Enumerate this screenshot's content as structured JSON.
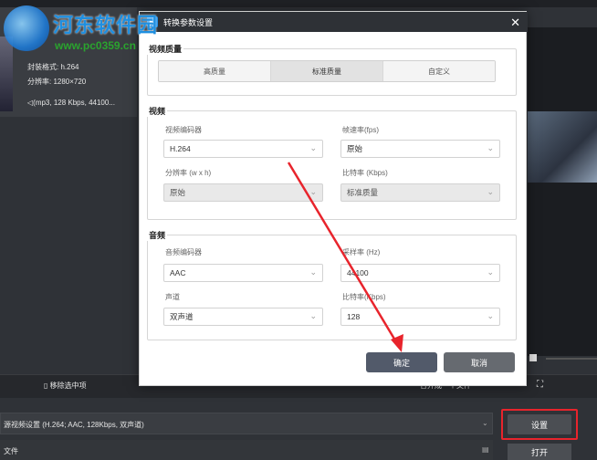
{
  "app": {
    "file_info": {
      "format_line": "封装格式: h.264",
      "resolution_line": "分辨率: 1280×720",
      "audio_line": "(mp3, 128 Kbps, 44100..."
    },
    "remove_selected": "移除选中项",
    "source_settings_line": "源视频设置 (H.264; AAC, 128Kbps, 双声道)",
    "file_label": "文件",
    "settings_button": "设置",
    "open_button": "打开",
    "merge_label": "合并成一个文件"
  },
  "watermark": {
    "title": "河东软件园",
    "url": "www.pc0359.cn"
  },
  "dialog": {
    "title": "转换参数设置",
    "close_icon": "close-icon",
    "quality_section": {
      "label": "视频质量",
      "options": [
        "高质量",
        "标准质量",
        "自定义"
      ],
      "selected": "标准质量"
    },
    "video_section": {
      "label": "视频",
      "encoder_label": "视频编码器",
      "encoder_value": "H.264",
      "framerate_label": "帧速率(fps)",
      "framerate_value": "原始",
      "resolution_label": "分辨率 (w x h)",
      "resolution_value": "原始",
      "bitrate_label": "比特率 (Kbps)",
      "bitrate_value": "标准质量"
    },
    "audio_section": {
      "label": "音频",
      "encoder_label": "音频编码器",
      "encoder_value": "AAC",
      "samplerate_label": "采样率 (Hz)",
      "samplerate_value": "44100",
      "channel_label": "声道",
      "channel_value": "双声道",
      "bitrate_label": "比特率(Kbps)",
      "bitrate_value": "128"
    },
    "ok_button": "确定",
    "cancel_button": "取消"
  },
  "colors": {
    "ok_button": "#525a6a",
    "cancel_button": "#666a70",
    "annotation_red": "#e8242c"
  }
}
